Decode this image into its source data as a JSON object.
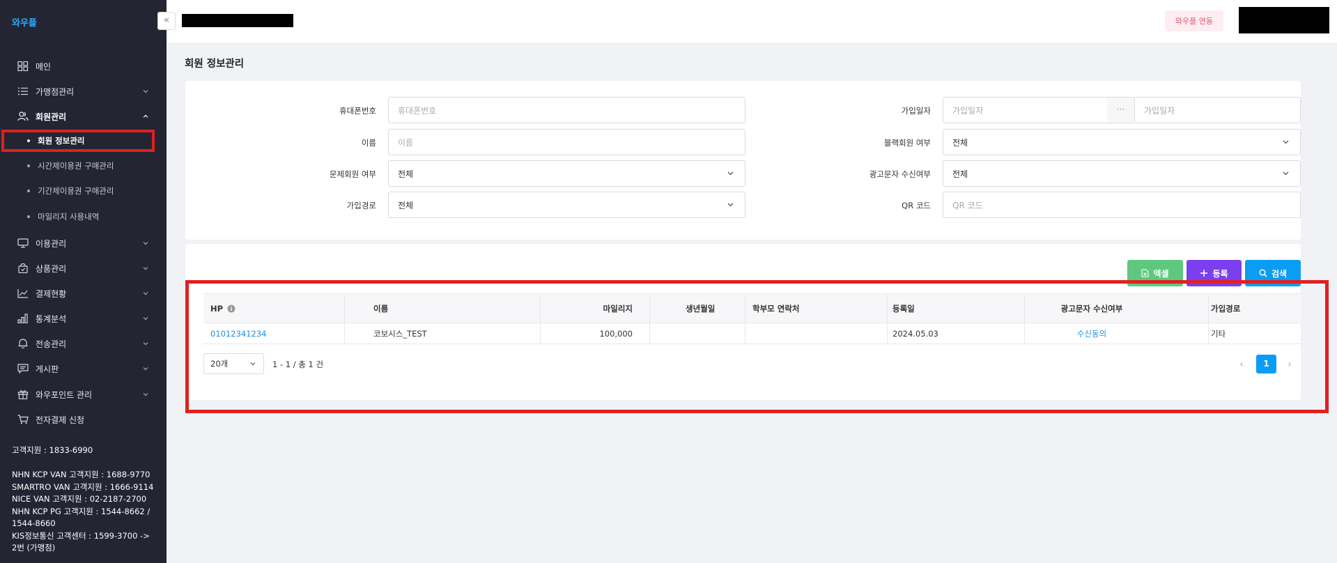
{
  "sidebar": {
    "logo": "와우플",
    "collapse_label": "«",
    "items": [
      {
        "label": "메인",
        "icon": "grid-icon"
      },
      {
        "label": "가맹점관리",
        "icon": "list-icon"
      },
      {
        "label": "회원관리",
        "icon": "users-icon"
      },
      {
        "label": "이용관리",
        "icon": "monitor-icon"
      },
      {
        "label": "상품관리",
        "icon": "bag-icon"
      },
      {
        "label": "결제현황",
        "icon": "trend-icon"
      },
      {
        "label": "통계분석",
        "icon": "bar-chart-icon"
      },
      {
        "label": "전송관리",
        "icon": "bell-icon"
      },
      {
        "label": "게시판",
        "icon": "message-icon"
      },
      {
        "label": "와우포인트 관리",
        "icon": "gift-icon"
      },
      {
        "label": "전자결제 신청",
        "icon": "cart-icon"
      }
    ],
    "subitems": [
      {
        "label": "회원 정보관리"
      },
      {
        "label": "시간제이용권 구매관리"
      },
      {
        "label": "기간제이용권 구매관리"
      },
      {
        "label": "마일리지 사용내역"
      }
    ],
    "support": {
      "main": "고객지원 : 1833-6990",
      "lines": [
        "NHN KCP VAN 고객지원 : 1688-9770",
        "SMARTRO VAN 고객지원 : 1666-9114",
        "NICE VAN 고객지원 : 02-2187-2700",
        "NHN KCP PG 고객지원 : 1544-8662 /",
        "1544-8660",
        "KIS정보통신 고객센터 : 1599-3700 ->",
        "2번 (가맹점)"
      ]
    }
  },
  "header": {
    "sync_button": "와우플 연동"
  },
  "page": {
    "title": "회원 정보관리"
  },
  "filters": {
    "phone": {
      "label": "휴대폰번호",
      "placeholder": "휴대폰번호"
    },
    "name": {
      "label": "이름",
      "placeholder": "이름"
    },
    "problem": {
      "label": "문제회원 여부",
      "value": "전체"
    },
    "route": {
      "label": "가입경로",
      "value": "전체"
    },
    "joindate": {
      "label": "가입일자",
      "from_placeholder": "가입일자",
      "sep": "···",
      "to_placeholder": "가입일자"
    },
    "blacklist": {
      "label": "블랙회원 여부",
      "value": "전체"
    },
    "ad": {
      "label": "광고문자 수신여부",
      "value": "전체"
    },
    "qr": {
      "label": "QR 코드",
      "placeholder": "QR 코드"
    }
  },
  "actions": {
    "excel": "엑셀",
    "register": "등록",
    "search": "검색"
  },
  "table": {
    "headers": {
      "hp": "HP",
      "name": "이름",
      "mileage": "마일리지",
      "birth": "생년월일",
      "parent": "학부모 연락처",
      "regdate": "등록일",
      "ad": "광고문자 수신여부",
      "route": "가입경로"
    },
    "rows": [
      {
        "hp": "01012341234",
        "name": "코보시스_TEST",
        "mileage": "100,000",
        "birth": "",
        "parent": "",
        "regdate": "2024.05.03",
        "ad": "수신동의",
        "route": "기타"
      }
    ]
  },
  "pagination": {
    "per_page": "20개",
    "info": "1 - 1 / 총 1 건",
    "prev": "‹",
    "current": "1",
    "next": "›"
  },
  "colors": {
    "sidebar_bg": "#232533",
    "accent_blue": "#0b9df3",
    "excel_green": "#5ec97e",
    "register_purple": "#7b3ff0",
    "highlight_red": "#e02020"
  }
}
